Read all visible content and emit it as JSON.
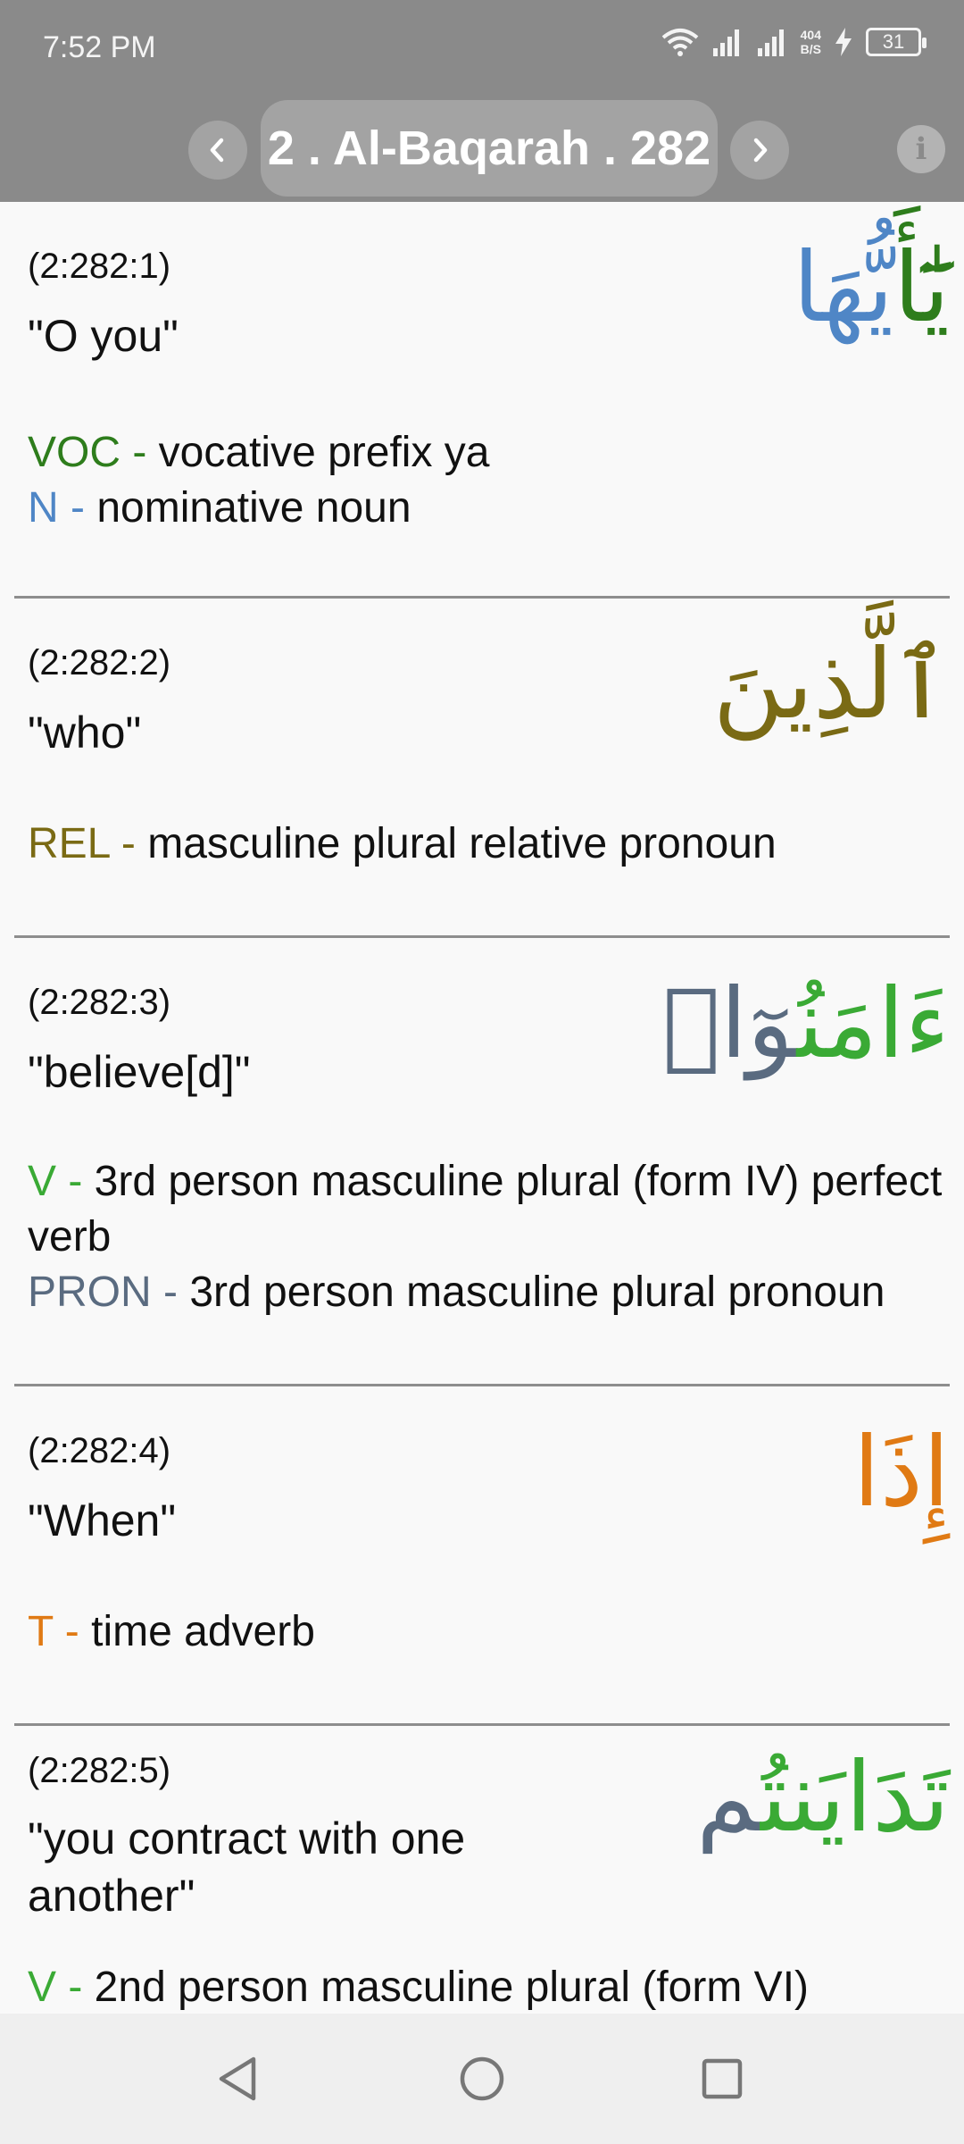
{
  "status": {
    "time": "7:52 PM",
    "net_speed_value": "404",
    "net_speed_unit": "B/S",
    "battery": "31"
  },
  "header": {
    "title": "2 . Al-Baqarah . 282"
  },
  "words": [
    {
      "location": "(2:282:1)",
      "gloss": "\"O you\"",
      "arabic": [
        {
          "text": "يَٰٓأَ",
          "color": "#2e7d1c"
        },
        {
          "text": "يُّهَا",
          "color": "#4f86c6"
        }
      ],
      "tags": [
        {
          "abbr": "VOC - ",
          "color": "#2e7d1c",
          "desc": "vocative prefix ya"
        },
        {
          "abbr": "N - ",
          "color": "#4f86c6",
          "desc": " nominative noun"
        }
      ]
    },
    {
      "location": "(2:282:2)",
      "gloss": "\"who\"",
      "arabic": [
        {
          "text": "ٱلَّذِينَ",
          "color": "#7a6a14"
        }
      ],
      "tags": [
        {
          "abbr": "REL - ",
          "color": "#7a6a14",
          "desc": " masculine plural relative pronoun"
        }
      ]
    },
    {
      "location": "(2:282:3)",
      "gloss": "\"believe[d]\"",
      "arabic": [
        {
          "text": "ءَامَنُ",
          "color": "#3aaa35"
        },
        {
          "text": "وٓا۟",
          "color": "#5a6b80"
        }
      ],
      "tags": [
        {
          "abbr": "V - ",
          "color": "#3aaa35",
          "desc": " 3rd person masculine plural (form IV) perfect verb"
        },
        {
          "abbr": "PRON - ",
          "color": "#5a6b80",
          "desc": " 3rd person masculine plural pronoun"
        }
      ]
    },
    {
      "location": "(2:282:4)",
      "gloss": "\"When\"",
      "arabic": [
        {
          "text": "إِذَا",
          "color": "#e07a14"
        }
      ],
      "tags": [
        {
          "abbr": "T - ",
          "color": "#e07a14",
          "desc": " time adverb"
        }
      ]
    },
    {
      "location": "(2:282:5)",
      "gloss": "\"you contract with one another\"",
      "arabic": [
        {
          "text": "تَدَايَنتُ",
          "color": "#3aaa35"
        },
        {
          "text": "م",
          "color": "#5a6b80"
        }
      ],
      "tags": [
        {
          "abbr": "V - ",
          "color": "#3aaa35",
          "desc": " 2nd person masculine plural (form VI)"
        }
      ]
    }
  ]
}
